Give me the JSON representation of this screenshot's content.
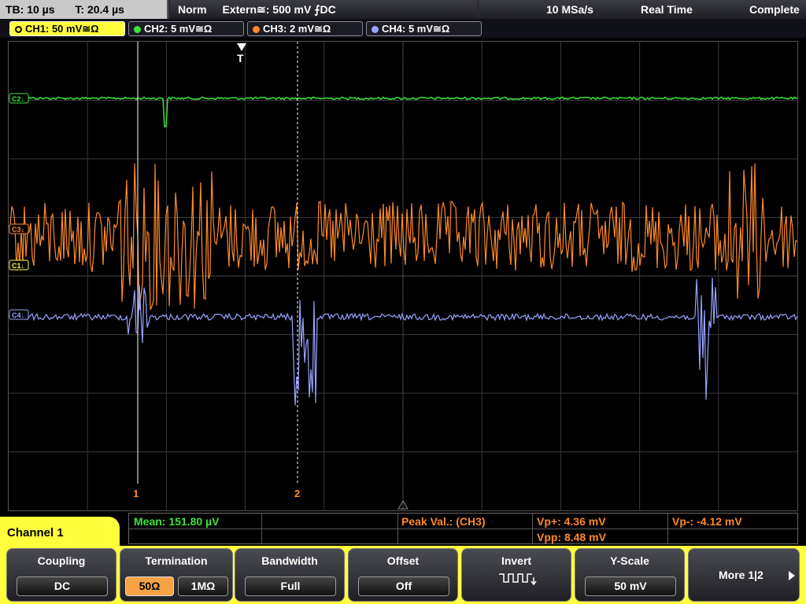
{
  "status": {
    "tb": "TB: 10 µs",
    "t": "T: 20.4 µs",
    "mode": "Norm",
    "trigger": "Extern≅: 500 mV ⨍DC",
    "samplerate": "10 MSa/s",
    "acq": "Real Time",
    "state": "Complete"
  },
  "channels": [
    {
      "label": "CH1: 50 mV≅Ω",
      "color": "#ffff3c"
    },
    {
      "label": "CH2: 5 mV≅Ω",
      "color": "#39e639"
    },
    {
      "label": "CH3: 2 mV≅Ω",
      "color": "#ff8a2a"
    },
    {
      "label": "CH4: 5 mV≅Ω",
      "color": "#9aa3ff"
    }
  ],
  "trigger_marker": "T",
  "cursors": {
    "c1": "1",
    "c2": "2"
  },
  "trace_tags": {
    "ch2": "C2↓",
    "ch3": "C3↓",
    "ch1": "C1↓",
    "ch4": "C4↓"
  },
  "measurements": {
    "mean": "Mean: 151.80 µV",
    "peak": "Peak Val.:  (CH3)",
    "vp_plus": "Vp+: 4.36 mV",
    "vp_minus": "Vp-: -4.12 mV",
    "vpp": "Vpp: 8.48 mV"
  },
  "menu_title": "Channel 1",
  "softkeys": {
    "coupling": {
      "title": "Coupling",
      "value": "DC"
    },
    "termination": {
      "title": "Termination",
      "opt1": "50Ω",
      "opt2": "1MΩ"
    },
    "bandwidth": {
      "title": "Bandwidth",
      "value": "Full"
    },
    "offset": {
      "title": "Offset",
      "value": "Off"
    },
    "invert": {
      "title": "Invert"
    },
    "yscale": {
      "title": "Y-Scale",
      "value": "50 mV"
    },
    "more": {
      "label": "More 1|2"
    }
  }
}
